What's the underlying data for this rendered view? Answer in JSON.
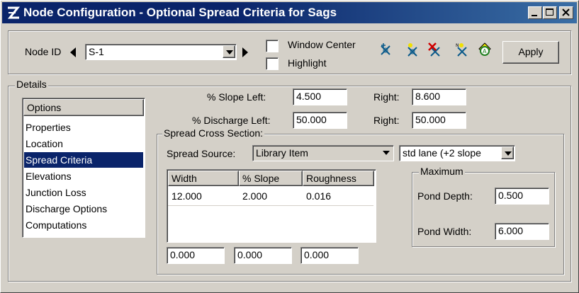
{
  "window": {
    "title": "Node Configuration - Optional Spread Criteria for Sags"
  },
  "toolbar": {
    "node_id_label": "Node ID",
    "node_id_value": "S-1",
    "window_center_label": "Window Center",
    "highlight_label": "Highlight",
    "apply_label": "Apply",
    "icons": [
      "add-node-icon",
      "new-node-icon",
      "delete-node-icon",
      "node-name-icon",
      "node-annotate-icon"
    ]
  },
  "details": {
    "legend": "Details",
    "options_header": "Options",
    "options": [
      "Properties",
      "Location",
      "Spread Criteria",
      "Elevations",
      "Junction Loss",
      "Discharge Options",
      "Computations"
    ],
    "selected_option": "Spread Criteria"
  },
  "slopes": {
    "slope_left_label": "% Slope Left:",
    "slope_left": "4.500",
    "slope_right_label": "Right:",
    "slope_right": "8.600",
    "discharge_left_label": "% Discharge Left:",
    "discharge_left": "50.000",
    "discharge_right_label": "Right:",
    "discharge_right": "50.000"
  },
  "spread": {
    "legend": "Spread Cross Section:",
    "source_label": "Spread Source:",
    "source_value": "Library Item",
    "library_value": "std lane (+2 slope",
    "table": {
      "headers": [
        "Width",
        "% Slope",
        "Roughness"
      ],
      "rows": [
        [
          "12.000",
          "2.000",
          "0.016"
        ]
      ]
    },
    "inputs": [
      "0.000",
      "0.000",
      "0.000"
    ],
    "maximum": {
      "legend": "Maximum",
      "pond_depth_label": "Pond Depth:",
      "pond_depth": "0.500",
      "pond_width_label": "Pond Width:",
      "pond_width": "6.000"
    }
  },
  "colors": {
    "title_bar": "#0a246a",
    "selection": "#0a246a",
    "face": "#d4d0c8"
  }
}
